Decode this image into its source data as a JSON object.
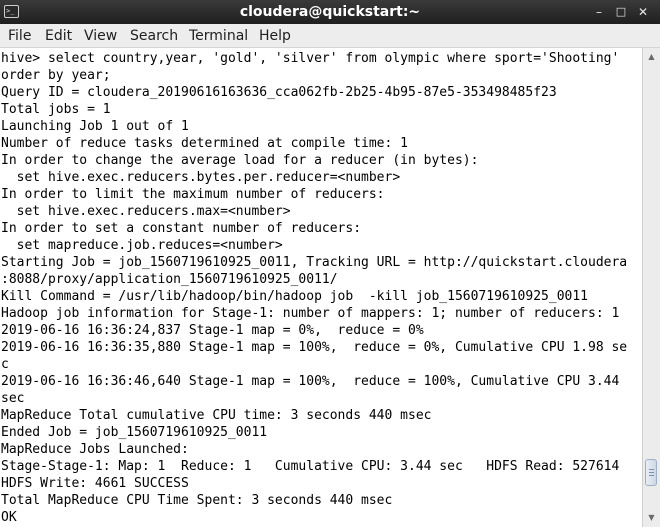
{
  "window": {
    "title": "cloudera@quickstart:~",
    "icon_text": ">_",
    "minimize_glyph": "–",
    "maximize_glyph": "□",
    "close_glyph": "✕"
  },
  "menubar": {
    "items": [
      "File",
      "Edit",
      "View",
      "Search",
      "Terminal",
      "Help"
    ]
  },
  "terminal": {
    "lines": [
      "hive> select country,year, 'gold', 'silver' from olympic where sport='Shooting'",
      "order by year;",
      "Query ID = cloudera_20190616163636_cca062fb-2b25-4b95-87e5-353498485f23",
      "Total jobs = 1",
      "Launching Job 1 out of 1",
      "Number of reduce tasks determined at compile time: 1",
      "In order to change the average load for a reducer (in bytes):",
      "  set hive.exec.reducers.bytes.per.reducer=<number>",
      "In order to limit the maximum number of reducers:",
      "  set hive.exec.reducers.max=<number>",
      "In order to set a constant number of reducers:",
      "  set mapreduce.job.reduces=<number>",
      "Starting Job = job_1560719610925_0011, Tracking URL = http://quickstart.cloudera",
      ":8088/proxy/application_1560719610925_0011/",
      "Kill Command = /usr/lib/hadoop/bin/hadoop job  -kill job_1560719610925_0011",
      "Hadoop job information for Stage-1: number of mappers: 1; number of reducers: 1",
      "2019-06-16 16:36:24,837 Stage-1 map = 0%,  reduce = 0%",
      "2019-06-16 16:36:35,880 Stage-1 map = 100%,  reduce = 0%, Cumulative CPU 1.98 se",
      "c",
      "2019-06-16 16:36:46,640 Stage-1 map = 100%,  reduce = 100%, Cumulative CPU 3.44",
      "sec",
      "MapReduce Total cumulative CPU time: 3 seconds 440 msec",
      "Ended Job = job_1560719610925_0011",
      "MapReduce Jobs Launched:",
      "Stage-Stage-1: Map: 1  Reduce: 1   Cumulative CPU: 3.44 sec   HDFS Read: 527614",
      "HDFS Write: 4661 SUCCESS",
      "Total MapReduce CPU Time Spent: 3 seconds 440 msec",
      "OK"
    ]
  },
  "scrollbar": {
    "up_glyph": "▲",
    "down_glyph": "▼",
    "scroll_position": 0.94,
    "visible_fraction": 0.06
  }
}
